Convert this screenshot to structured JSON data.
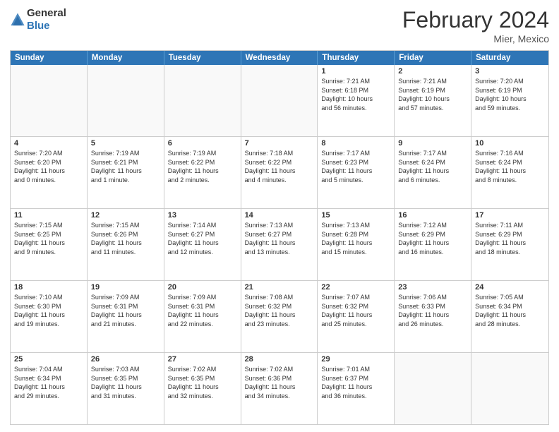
{
  "header": {
    "logo_general": "General",
    "logo_blue": "Blue",
    "month_title": "February 2024",
    "location": "Mier, Mexico"
  },
  "days_of_week": [
    "Sunday",
    "Monday",
    "Tuesday",
    "Wednesday",
    "Thursday",
    "Friday",
    "Saturday"
  ],
  "weeks": [
    [
      {
        "day": "",
        "info": ""
      },
      {
        "day": "",
        "info": ""
      },
      {
        "day": "",
        "info": ""
      },
      {
        "day": "",
        "info": ""
      },
      {
        "day": "1",
        "info": "Sunrise: 7:21 AM\nSunset: 6:18 PM\nDaylight: 10 hours\nand 56 minutes."
      },
      {
        "day": "2",
        "info": "Sunrise: 7:21 AM\nSunset: 6:19 PM\nDaylight: 10 hours\nand 57 minutes."
      },
      {
        "day": "3",
        "info": "Sunrise: 7:20 AM\nSunset: 6:19 PM\nDaylight: 10 hours\nand 59 minutes."
      }
    ],
    [
      {
        "day": "4",
        "info": "Sunrise: 7:20 AM\nSunset: 6:20 PM\nDaylight: 11 hours\nand 0 minutes."
      },
      {
        "day": "5",
        "info": "Sunrise: 7:19 AM\nSunset: 6:21 PM\nDaylight: 11 hours\nand 1 minute."
      },
      {
        "day": "6",
        "info": "Sunrise: 7:19 AM\nSunset: 6:22 PM\nDaylight: 11 hours\nand 2 minutes."
      },
      {
        "day": "7",
        "info": "Sunrise: 7:18 AM\nSunset: 6:22 PM\nDaylight: 11 hours\nand 4 minutes."
      },
      {
        "day": "8",
        "info": "Sunrise: 7:17 AM\nSunset: 6:23 PM\nDaylight: 11 hours\nand 5 minutes."
      },
      {
        "day": "9",
        "info": "Sunrise: 7:17 AM\nSunset: 6:24 PM\nDaylight: 11 hours\nand 6 minutes."
      },
      {
        "day": "10",
        "info": "Sunrise: 7:16 AM\nSunset: 6:24 PM\nDaylight: 11 hours\nand 8 minutes."
      }
    ],
    [
      {
        "day": "11",
        "info": "Sunrise: 7:15 AM\nSunset: 6:25 PM\nDaylight: 11 hours\nand 9 minutes."
      },
      {
        "day": "12",
        "info": "Sunrise: 7:15 AM\nSunset: 6:26 PM\nDaylight: 11 hours\nand 11 minutes."
      },
      {
        "day": "13",
        "info": "Sunrise: 7:14 AM\nSunset: 6:27 PM\nDaylight: 11 hours\nand 12 minutes."
      },
      {
        "day": "14",
        "info": "Sunrise: 7:13 AM\nSunset: 6:27 PM\nDaylight: 11 hours\nand 13 minutes."
      },
      {
        "day": "15",
        "info": "Sunrise: 7:13 AM\nSunset: 6:28 PM\nDaylight: 11 hours\nand 15 minutes."
      },
      {
        "day": "16",
        "info": "Sunrise: 7:12 AM\nSunset: 6:29 PM\nDaylight: 11 hours\nand 16 minutes."
      },
      {
        "day": "17",
        "info": "Sunrise: 7:11 AM\nSunset: 6:29 PM\nDaylight: 11 hours\nand 18 minutes."
      }
    ],
    [
      {
        "day": "18",
        "info": "Sunrise: 7:10 AM\nSunset: 6:30 PM\nDaylight: 11 hours\nand 19 minutes."
      },
      {
        "day": "19",
        "info": "Sunrise: 7:09 AM\nSunset: 6:31 PM\nDaylight: 11 hours\nand 21 minutes."
      },
      {
        "day": "20",
        "info": "Sunrise: 7:09 AM\nSunset: 6:31 PM\nDaylight: 11 hours\nand 22 minutes."
      },
      {
        "day": "21",
        "info": "Sunrise: 7:08 AM\nSunset: 6:32 PM\nDaylight: 11 hours\nand 23 minutes."
      },
      {
        "day": "22",
        "info": "Sunrise: 7:07 AM\nSunset: 6:32 PM\nDaylight: 11 hours\nand 25 minutes."
      },
      {
        "day": "23",
        "info": "Sunrise: 7:06 AM\nSunset: 6:33 PM\nDaylight: 11 hours\nand 26 minutes."
      },
      {
        "day": "24",
        "info": "Sunrise: 7:05 AM\nSunset: 6:34 PM\nDaylight: 11 hours\nand 28 minutes."
      }
    ],
    [
      {
        "day": "25",
        "info": "Sunrise: 7:04 AM\nSunset: 6:34 PM\nDaylight: 11 hours\nand 29 minutes."
      },
      {
        "day": "26",
        "info": "Sunrise: 7:03 AM\nSunset: 6:35 PM\nDaylight: 11 hours\nand 31 minutes."
      },
      {
        "day": "27",
        "info": "Sunrise: 7:02 AM\nSunset: 6:35 PM\nDaylight: 11 hours\nand 32 minutes."
      },
      {
        "day": "28",
        "info": "Sunrise: 7:02 AM\nSunset: 6:36 PM\nDaylight: 11 hours\nand 34 minutes."
      },
      {
        "day": "29",
        "info": "Sunrise: 7:01 AM\nSunset: 6:37 PM\nDaylight: 11 hours\nand 36 minutes."
      },
      {
        "day": "",
        "info": ""
      },
      {
        "day": "",
        "info": ""
      }
    ]
  ]
}
